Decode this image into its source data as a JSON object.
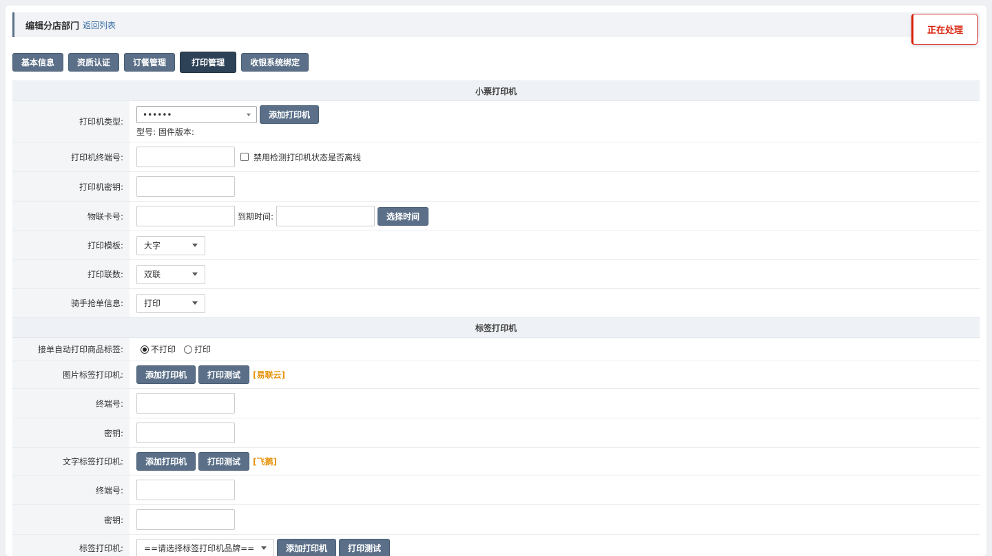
{
  "header": {
    "title": "编辑分店部门",
    "back_link": "返回列表"
  },
  "toast": {
    "text": "正在处理"
  },
  "tabs": [
    {
      "label": "基本信息"
    },
    {
      "label": "资质认证"
    },
    {
      "label": "订餐管理"
    },
    {
      "label": "打印管理"
    },
    {
      "label": "收银系统绑定"
    }
  ],
  "receipt_printer": {
    "section_title": "小票打印机",
    "printer_type": {
      "label": "打印机类型:",
      "value": "••••••",
      "add_button": "添加打印机",
      "model_info": "型号: 固件版本:"
    },
    "terminal_no": {
      "label": "打印机终端号:",
      "value": "",
      "checkbox_label": "禁用检测打印机状态是否离线"
    },
    "secret_key": {
      "label": "打印机密钥:",
      "value": ""
    },
    "iot_card": {
      "label": "物联卡号:",
      "value": "",
      "expire_label": "到期时间:",
      "expire_value": "",
      "select_time_button": "选择时间"
    },
    "template": {
      "label": "打印模板:",
      "value": "大字"
    },
    "copies": {
      "label": "打印联数:",
      "value": "双联"
    },
    "rider_info": {
      "label": "骑手抢单信息:",
      "value": "打印"
    }
  },
  "label_printer": {
    "section_title": "标签打印机",
    "auto_print": {
      "label": "接单自动打印商品标签:",
      "option_no": "不打印",
      "option_yes": "打印"
    },
    "image_printer": {
      "label": "图片标签打印机:",
      "add_button": "添加打印机",
      "test_button": "打印测试",
      "brand": "[易联云]"
    },
    "image_terminal": {
      "label": "终端号:",
      "value": ""
    },
    "image_key": {
      "label": "密钥:",
      "value": ""
    },
    "text_printer": {
      "label": "文字标签打印机:",
      "add_button": "添加打印机",
      "test_button": "打印测试",
      "brand": "[飞鹅]"
    },
    "text_terminal": {
      "label": "终端号:",
      "value": ""
    },
    "text_key": {
      "label": "密钥:",
      "value": ""
    },
    "brand_printer": {
      "label": "标签打印机:",
      "value": "==请选择标签打印机品牌==",
      "add_button": "添加打印机",
      "test_button": "打印测试"
    }
  }
}
